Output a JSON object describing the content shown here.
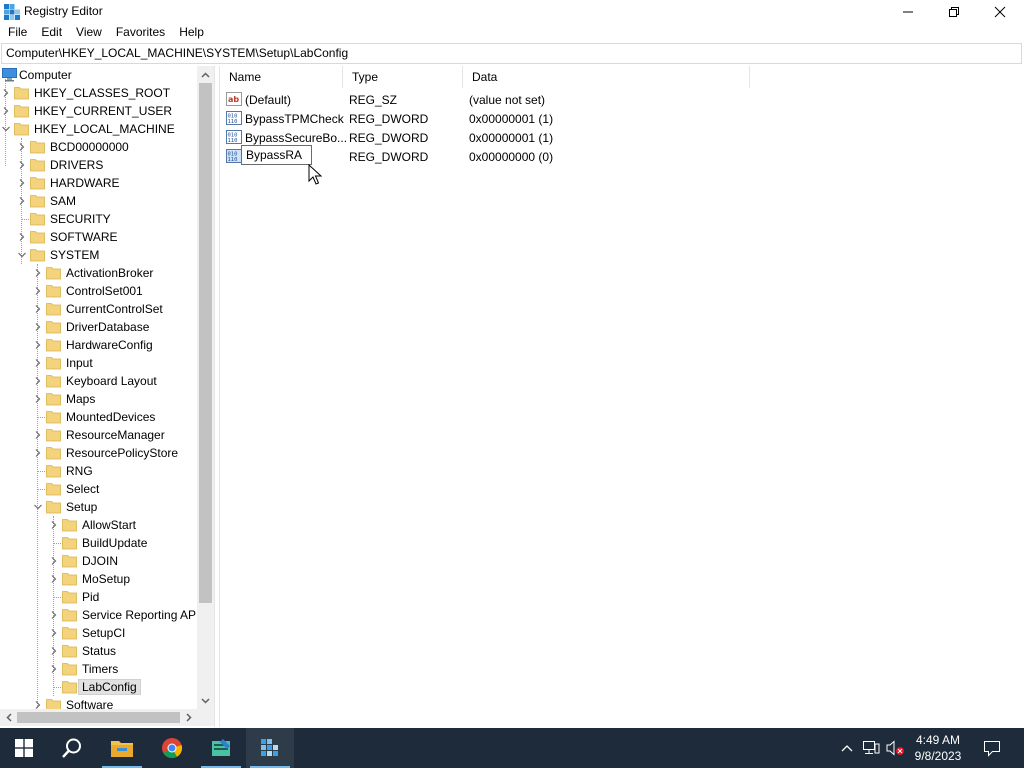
{
  "window": {
    "title": "Registry Editor",
    "controls": [
      "minimize",
      "maximize",
      "close"
    ]
  },
  "menu": [
    "File",
    "Edit",
    "View",
    "Favorites",
    "Help"
  ],
  "address": "Computer\\HKEY_LOCAL_MACHINE\\SYSTEM\\Setup\\LabConfig",
  "tree": [
    {
      "label": "Computer",
      "level": 0,
      "expander": "none",
      "icon": "computer-icon"
    },
    {
      "label": "HKEY_CLASSES_ROOT",
      "level": 1,
      "expander": "collapsed",
      "icon": "folder-icon"
    },
    {
      "label": "HKEY_CURRENT_USER",
      "level": 1,
      "expander": "collapsed",
      "icon": "folder-icon"
    },
    {
      "label": "HKEY_LOCAL_MACHINE",
      "level": 1,
      "expander": "expanded",
      "icon": "folder-icon"
    },
    {
      "label": "BCD00000000",
      "level": 2,
      "expander": "collapsed",
      "icon": "folder-icon"
    },
    {
      "label": "DRIVERS",
      "level": 2,
      "expander": "collapsed",
      "icon": "folder-icon"
    },
    {
      "label": "HARDWARE",
      "level": 2,
      "expander": "collapsed",
      "icon": "folder-icon"
    },
    {
      "label": "SAM",
      "level": 2,
      "expander": "collapsed",
      "icon": "folder-icon"
    },
    {
      "label": "SECURITY",
      "level": 2,
      "expander": "none",
      "icon": "folder-icon"
    },
    {
      "label": "SOFTWARE",
      "level": 2,
      "expander": "collapsed",
      "icon": "folder-icon"
    },
    {
      "label": "SYSTEM",
      "level": 2,
      "expander": "expanded",
      "icon": "folder-icon"
    },
    {
      "label": "ActivationBroker",
      "level": 3,
      "expander": "collapsed",
      "icon": "folder-icon"
    },
    {
      "label": "ControlSet001",
      "level": 3,
      "expander": "collapsed",
      "icon": "folder-icon"
    },
    {
      "label": "CurrentControlSet",
      "level": 3,
      "expander": "collapsed",
      "icon": "folder-icon"
    },
    {
      "label": "DriverDatabase",
      "level": 3,
      "expander": "collapsed",
      "icon": "folder-icon"
    },
    {
      "label": "HardwareConfig",
      "level": 3,
      "expander": "collapsed",
      "icon": "folder-icon"
    },
    {
      "label": "Input",
      "level": 3,
      "expander": "collapsed",
      "icon": "folder-icon"
    },
    {
      "label": "Keyboard Layout",
      "level": 3,
      "expander": "collapsed",
      "icon": "folder-icon"
    },
    {
      "label": "Maps",
      "level": 3,
      "expander": "collapsed",
      "icon": "folder-icon"
    },
    {
      "label": "MountedDevices",
      "level": 3,
      "expander": "none",
      "icon": "folder-icon"
    },
    {
      "label": "ResourceManager",
      "level": 3,
      "expander": "collapsed",
      "icon": "folder-icon"
    },
    {
      "label": "ResourcePolicyStore",
      "level": 3,
      "expander": "collapsed",
      "icon": "folder-icon"
    },
    {
      "label": "RNG",
      "level": 3,
      "expander": "none",
      "icon": "folder-icon"
    },
    {
      "label": "Select",
      "level": 3,
      "expander": "none",
      "icon": "folder-icon"
    },
    {
      "label": "Setup",
      "level": 3,
      "expander": "expanded",
      "icon": "folder-icon"
    },
    {
      "label": "AllowStart",
      "level": 4,
      "expander": "collapsed",
      "icon": "folder-icon"
    },
    {
      "label": "BuildUpdate",
      "level": 4,
      "expander": "none",
      "icon": "folder-icon"
    },
    {
      "label": "DJOIN",
      "level": 4,
      "expander": "collapsed",
      "icon": "folder-icon"
    },
    {
      "label": "MoSetup",
      "level": 4,
      "expander": "collapsed",
      "icon": "folder-icon"
    },
    {
      "label": "Pid",
      "level": 4,
      "expander": "none",
      "icon": "folder-icon"
    },
    {
      "label": "Service Reporting API",
      "level": 4,
      "expander": "collapsed",
      "icon": "folder-icon"
    },
    {
      "label": "SetupCI",
      "level": 4,
      "expander": "collapsed",
      "icon": "folder-icon"
    },
    {
      "label": "Status",
      "level": 4,
      "expander": "collapsed",
      "icon": "folder-icon"
    },
    {
      "label": "Timers",
      "level": 4,
      "expander": "collapsed",
      "icon": "folder-icon"
    },
    {
      "label": "LabConfig",
      "level": 4,
      "expander": "none",
      "icon": "folder-icon",
      "selected": true
    },
    {
      "label": "Software",
      "level": 3,
      "expander": "collapsed",
      "icon": "folder-icon"
    }
  ],
  "list": {
    "columns": [
      "Name",
      "Type",
      "Data"
    ],
    "rows": [
      {
        "name": "(Default)",
        "type": "REG_SZ",
        "data": "(value not set)",
        "icon": "string-value-icon"
      },
      {
        "name": "BypassTPMCheck",
        "type": "REG_DWORD",
        "data": "0x00000001 (1)",
        "icon": "dword-value-icon"
      },
      {
        "name": "BypassSecureBo...",
        "type": "REG_DWORD",
        "data": "0x00000001 (1)",
        "icon": "dword-value-icon"
      },
      {
        "name": "BypassRA",
        "type": "REG_DWORD",
        "data": "0x00000000 (0)",
        "icon": "dword-value-icon",
        "editing": true
      }
    ]
  },
  "taskbar": {
    "apps": [
      "start-icon",
      "search-icon",
      "file-explorer-icon",
      "chrome-icon",
      "notepad-icon",
      "registry-editor-icon"
    ],
    "active_app": "registry-editor-icon",
    "time": "4:49 AM",
    "date": "9/8/2023"
  },
  "colors": {
    "taskbar": "#1d2b3a",
    "folder": "#f4d37d",
    "selection": "#e1e1e1",
    "accent": "#76b9ed"
  }
}
